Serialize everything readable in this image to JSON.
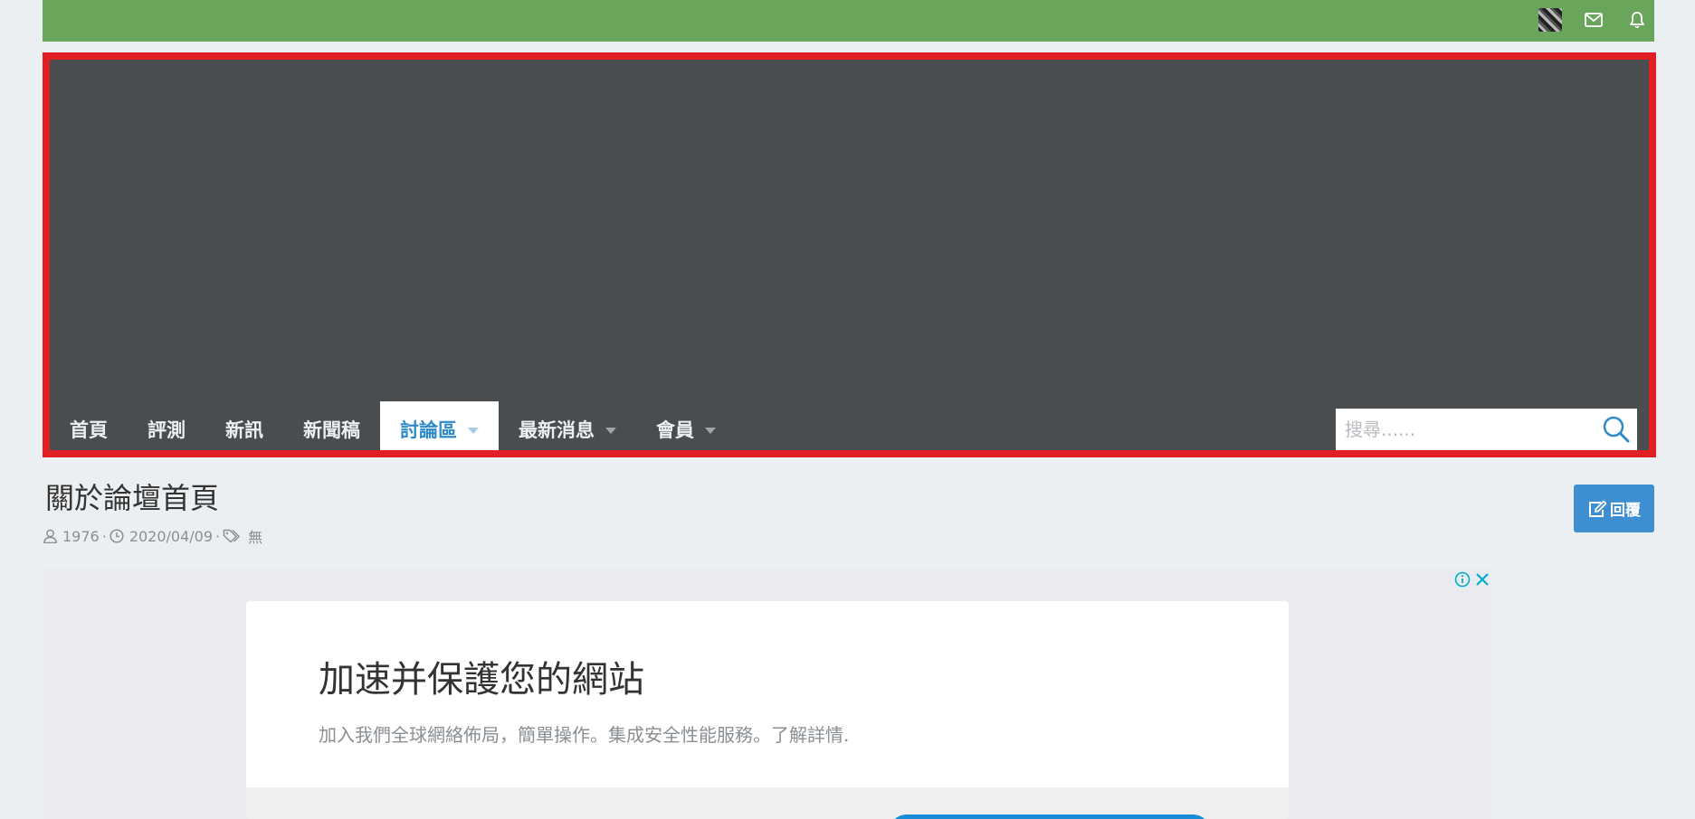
{
  "topbar": {
    "icons": [
      "user-avatar",
      "mail-icon",
      "bell-icon"
    ],
    "color": "#6aa55c"
  },
  "banner": {
    "border_color": "#e31f26",
    "background": "#4a4d50"
  },
  "nav": {
    "items": [
      {
        "label": "首頁",
        "dropdown": false,
        "active": false
      },
      {
        "label": "評測",
        "dropdown": false,
        "active": false
      },
      {
        "label": "新訊",
        "dropdown": false,
        "active": false
      },
      {
        "label": "新聞稿",
        "dropdown": false,
        "active": false
      },
      {
        "label": "討論區",
        "dropdown": true,
        "active": true
      },
      {
        "label": "最新消息",
        "dropdown": true,
        "active": false
      },
      {
        "label": "會員",
        "dropdown": true,
        "active": false
      }
    ]
  },
  "search": {
    "placeholder": "搜尋......",
    "value": ""
  },
  "page": {
    "title": "關於論壇首頁",
    "author": "1976",
    "date": "2020/04/09",
    "tags": "無",
    "separator": "·",
    "reply_label": "回覆"
  },
  "ad": {
    "title": "加速并保護您的網站",
    "text": "加入我們全球網絡佈局，簡單操作。集成安全性能服務。了解詳情.",
    "icons": [
      "info-icon",
      "close-icon"
    ]
  },
  "colors": {
    "accent": "#2e8bcb",
    "reply_button": "#3d8fd1"
  }
}
